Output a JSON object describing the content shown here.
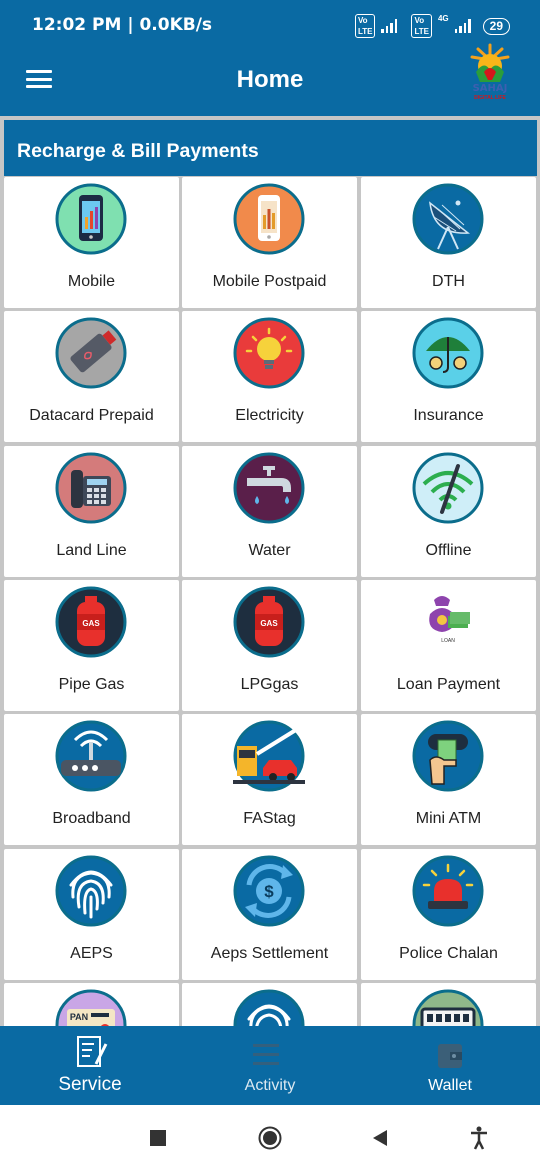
{
  "status_bar": {
    "time": "12:02 PM | 0.0KB/s",
    "volte1": "Vo LTE",
    "volte2": "Vo LTE",
    "network": "4G",
    "battery": "29"
  },
  "app_bar": {
    "title": "Home",
    "logo_text": "SAHAJ",
    "logo_subtext": "DIGITAL LIFE"
  },
  "section": {
    "title": "Recharge & Bill Payments"
  },
  "services": [
    {
      "label": "Mobile",
      "icon": "mobile-icon"
    },
    {
      "label": "Mobile Postpaid",
      "icon": "mobile-postpaid-icon"
    },
    {
      "label": "DTH",
      "icon": "dth-dish-icon"
    },
    {
      "label": "Datacard Prepaid",
      "icon": "datacard-icon"
    },
    {
      "label": "Electricity",
      "icon": "bulb-icon"
    },
    {
      "label": "Insurance",
      "icon": "umbrella-icon"
    },
    {
      "label": "Land Line",
      "icon": "landline-phone-icon"
    },
    {
      "label": "Water",
      "icon": "water-tap-icon"
    },
    {
      "label": "Offline",
      "icon": "wifi-off-icon"
    },
    {
      "label": "Pipe Gas",
      "icon": "gas-cylinder-icon",
      "icon_text": "GAS"
    },
    {
      "label": "LPGgas",
      "icon": "gas-cylinder-icon",
      "icon_text": "GAS"
    },
    {
      "label": "Loan Payment",
      "icon": "loan-icon",
      "icon_text": "LOAN"
    },
    {
      "label": "Broadband",
      "icon": "router-icon"
    },
    {
      "label": "FAStag",
      "icon": "toll-gate-icon"
    },
    {
      "label": "Mini ATM",
      "icon": "atm-hand-icon"
    },
    {
      "label": "AEPS",
      "icon": "fingerprint-icon"
    },
    {
      "label": "Aeps Settlement",
      "icon": "dollar-cycle-icon"
    },
    {
      "label": "Police Chalan",
      "icon": "siren-icon"
    },
    {
      "label": "",
      "icon": "pan-card-icon",
      "icon_text": "PAN"
    },
    {
      "label": "",
      "icon": "fingerprint-icon"
    },
    {
      "label": "",
      "icon": "bus-icon"
    }
  ],
  "bottom_nav": [
    {
      "label": "Service",
      "icon": "service-doc-icon",
      "active": true
    },
    {
      "label": "Activity",
      "icon": "activity-list-icon",
      "active": false
    },
    {
      "label": "Wallet",
      "icon": "wallet-icon",
      "active": false
    }
  ],
  "colors": {
    "primary": "#0a6aa3",
    "background": "#c6c6c6",
    "tile": "#ffffff"
  }
}
